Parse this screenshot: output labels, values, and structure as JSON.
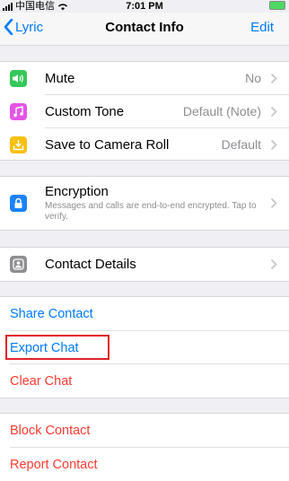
{
  "status_bar": {
    "carrier": "中国电信",
    "time": "7:01 PM"
  },
  "nav": {
    "back_label": "Lyric",
    "title": "Contact Info",
    "edit_label": "Edit"
  },
  "settings": {
    "mute": {
      "label": "Mute",
      "value": "No",
      "icon_color": "#34c759"
    },
    "custom_tone": {
      "label": "Custom Tone",
      "value": "Default (Note)",
      "icon_color": "#e455e8"
    },
    "save_camera_roll": {
      "label": "Save to Camera Roll",
      "value": "Default",
      "icon_color": "#f8c012"
    }
  },
  "encryption": {
    "label": "Encryption",
    "description": "Messages and calls are end-to-end encrypted. Tap to verify.",
    "icon_color": "#1a82fb"
  },
  "contact_details": {
    "label": "Contact Details",
    "icon_color": "#8e8e93"
  },
  "actions": {
    "share": "Share Contact",
    "export": "Export Chat",
    "clear": "Clear Chat",
    "block": "Block Contact",
    "report": "Report Contact"
  },
  "colors": {
    "link": "#007aff",
    "destructive": "#ff3b30",
    "highlight_box": "#e0202a"
  }
}
